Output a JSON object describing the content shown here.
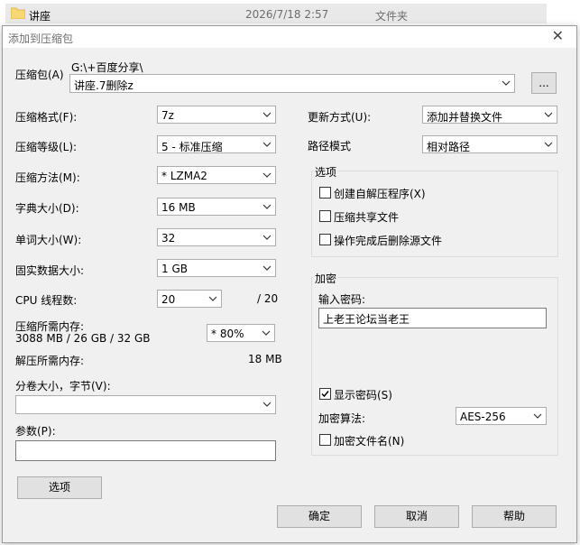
{
  "background": {
    "file_name": "讲座",
    "file_date": "2026/7/18 2:57",
    "file_type": "文件夹"
  },
  "dialog": {
    "title": "添加到压缩包",
    "archive_label": "压缩包(A)",
    "archive_path": "G:\\+百度分享\\",
    "archive_name": "讲座.7删除z",
    "browse_label": "...",
    "format_label": "压缩格式(F):",
    "format_value": "7z",
    "level_label": "压缩等级(L):",
    "level_value": "5 - 标准压缩",
    "method_label": "压缩方法(M):",
    "method_value": "* LZMA2",
    "dict_label": "字典大小(D):",
    "dict_value": "16 MB",
    "word_label": "单词大小(W):",
    "word_value": "32",
    "solid_label": "固实数据大小:",
    "solid_value": "1 GB",
    "cpu_label": "CPU 线程数:",
    "cpu_value": "20",
    "cpu_total": "/ 20",
    "mem_comp_label": "压缩所需内存:",
    "mem_comp_value": "3088 MB / 26 GB / 32 GB",
    "mem_percent": "* 80%",
    "mem_decomp_label": "解压所需内存:",
    "mem_decomp_value": "18 MB",
    "split_label": "分卷大小，字节(V):",
    "split_value": "",
    "params_label": "参数(P):",
    "params_value": "",
    "options_button": "选项",
    "update_label": "更新方式(U):",
    "update_value": "添加并替换文件",
    "path_label": "路径模式",
    "path_value": "相对路径",
    "options_group": "选项",
    "opt_sfx": "创建自解压程序(X)",
    "opt_shared": "压缩共享文件",
    "opt_delete": "操作完成后删除源文件",
    "encrypt_group": "加密",
    "password_label": "输入密码:",
    "password_value": "上老王论坛当老王",
    "show_password": "显示密码(S)",
    "encrypt_method_label": "加密算法:",
    "encrypt_method_value": "AES-256",
    "encrypt_names": "加密文件名(N)",
    "ok_button": "确定",
    "cancel_button": "取消",
    "help_button": "帮助"
  }
}
